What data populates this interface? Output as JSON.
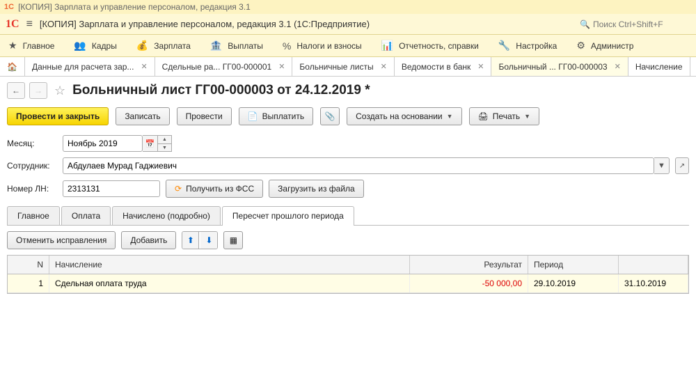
{
  "titlebar": "[КОПИЯ] Зарплата и управление персоналом, редакция 3.1",
  "appbar": {
    "title": "[КОПИЯ] Зарплата и управление персоналом, редакция 3.1  (1С:Предприятие)",
    "search_placeholder": "Поиск Ctrl+Shift+F"
  },
  "menu": {
    "main": "Главное",
    "kadry": "Кадры",
    "zarplata": "Зарплата",
    "vyplaty": "Выплаты",
    "nalogi": "Налоги и взносы",
    "otchet": "Отчетность, справки",
    "nastroyka": "Настройка",
    "admin": "Администр"
  },
  "tabs": [
    {
      "label": "Данные для расчета зар...",
      "active": false
    },
    {
      "label": "Сдельные ра... ГГ00-000001",
      "active": false
    },
    {
      "label": "Больничные листы",
      "active": false
    },
    {
      "label": "Ведомости в банк",
      "active": false
    },
    {
      "label": "Больничный ... ГГ00-000003",
      "active": true
    },
    {
      "label": "Начисление",
      "active": false,
      "noclose": true
    }
  ],
  "doc": {
    "title": "Больничный лист ГГ00-000003 от 24.12.2019 *"
  },
  "toolbar": {
    "post_close": "Провести и закрыть",
    "write": "Записать",
    "post": "Провести",
    "pay": "Выплатить",
    "create_base": "Создать на основании",
    "print": "Печать"
  },
  "form": {
    "month_label": "Месяц:",
    "month_value": "Ноябрь 2019",
    "employee_label": "Сотрудник:",
    "employee_value": "Абдулаев Мурад Гаджиевич",
    "ln_label": "Номер ЛН:",
    "ln_value": "2313131",
    "get_fss": "Получить из ФСС",
    "load_file": "Загрузить из файла"
  },
  "inner_tabs": {
    "main": "Главное",
    "oplata": "Оплата",
    "nachisleno": "Начислено (подробно)",
    "pereschet": "Пересчет прошлого периода"
  },
  "subtoolbar": {
    "cancel": "Отменить исправления",
    "add": "Добавить"
  },
  "grid": {
    "headers": {
      "n": "N",
      "name": "Начисление",
      "result": "Результат",
      "period": "Период"
    },
    "rows": [
      {
        "n": "1",
        "name": "Сдельная оплата труда",
        "result": "-50 000,00",
        "period": "29.10.2019",
        "period_end": "31.10.2019"
      }
    ]
  }
}
